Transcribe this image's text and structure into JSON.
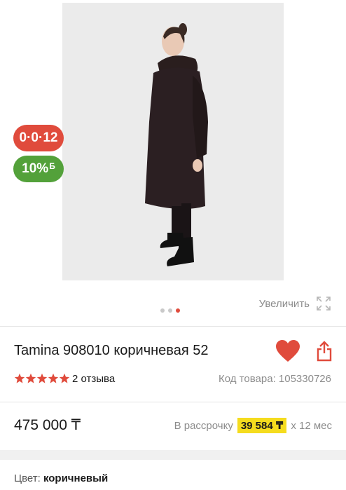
{
  "badges": {
    "installment": "0·0·12",
    "bonus": "10%",
    "bonus_currency": "Б"
  },
  "gallery": {
    "dots_count": 3,
    "active_dot": 2,
    "zoom_label": "Увеличить"
  },
  "product": {
    "title": "Tamina 908010 коричневая 52",
    "rating_stars": 5,
    "reviews_label": "2 отзыва",
    "sku_label": "Код товара: 105330726",
    "price": "475 000 ₸",
    "installment_prefix": "В рассрочку",
    "installment_amount": "39 584 ₸",
    "installment_suffix": "х 12 мес",
    "color_label": "Цвет:",
    "color_value": "коричневый"
  },
  "colors": {
    "accent_red": "#e04b3c",
    "bonus_green": "#53a13a",
    "highlight_yellow": "#f5dc1e"
  }
}
